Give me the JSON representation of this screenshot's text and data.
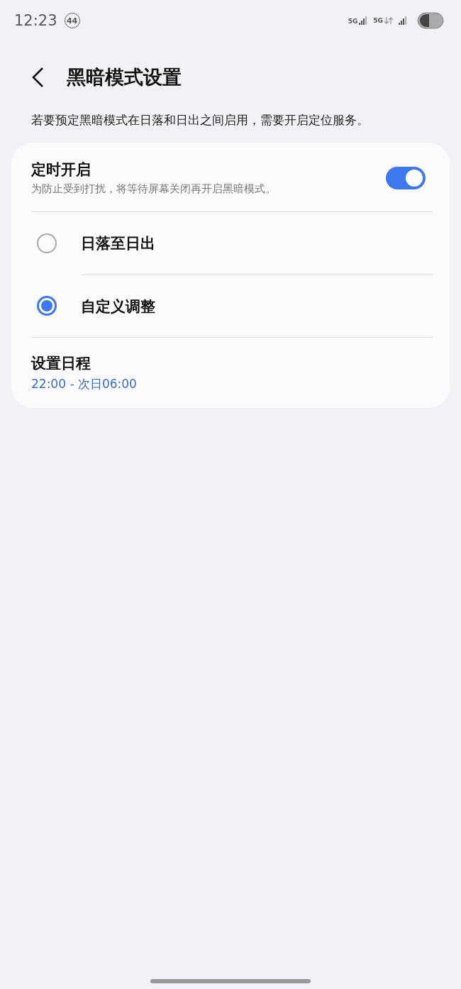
{
  "status_bar": {
    "time": "12:23",
    "notification_count": "44",
    "network_labels": [
      "5G",
      "5G"
    ]
  },
  "header": {
    "title": "黑暗模式设置"
  },
  "description": "若要预定黑暗模式在日落和日出之间启用，需要开启定位服务。",
  "schedule": {
    "label": "定时开启",
    "sublabel": "为防止受到打扰，将等待屏幕关闭再开启黑暗模式。",
    "on": true
  },
  "options": [
    {
      "label": "日落至日出",
      "selected": false
    },
    {
      "label": "自定义调整",
      "selected": true
    }
  ],
  "set_schedule": {
    "label": "设置日程",
    "value": "22:00 - 次日06:00"
  }
}
